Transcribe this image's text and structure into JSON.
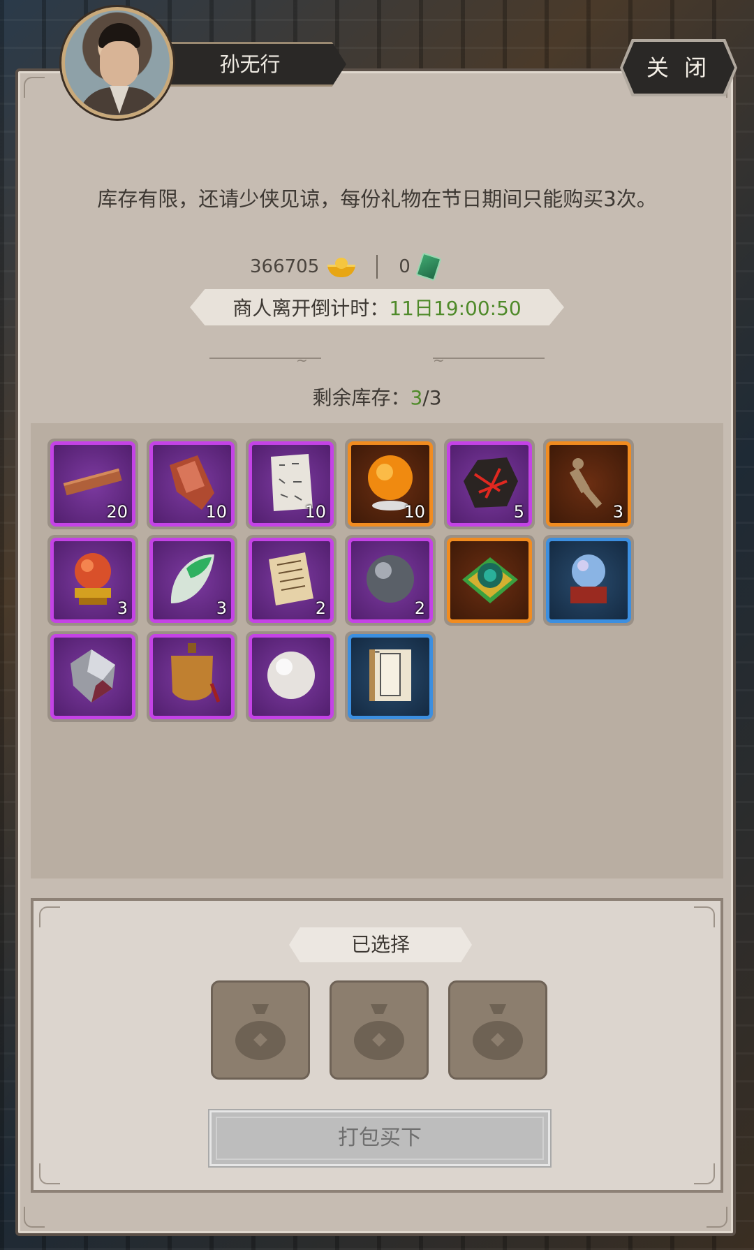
{
  "header": {
    "npc_name": "孙无行",
    "close_label": "关 闭"
  },
  "notice_text": "库存有限，还请少侠见谅，每份礼物在节日期间只能购买3次。",
  "currency": {
    "gold_amount": "366705",
    "gold_icon": "gold-ingot-icon",
    "jade_amount": "0",
    "jade_icon": "jade-token-icon"
  },
  "timer": {
    "label": "商人离开倒计时：",
    "value": "11日19:00:50"
  },
  "stock": {
    "label": "剩余库存：",
    "current": "3",
    "total": "/3"
  },
  "items": [
    {
      "name": "wood-plank",
      "rarity": "purple",
      "qty": "20"
    },
    {
      "name": "red-stone-shard",
      "rarity": "purple",
      "qty": "10"
    },
    {
      "name": "script-scroll",
      "rarity": "purple",
      "qty": "10"
    },
    {
      "name": "fire-orb",
      "rarity": "orange",
      "qty": "10"
    },
    {
      "name": "lava-ore",
      "rarity": "purple",
      "qty": "5"
    },
    {
      "name": "bronze-figure",
      "rarity": "orange",
      "qty": "3"
    },
    {
      "name": "red-orb-stand",
      "rarity": "purple",
      "qty": "3"
    },
    {
      "name": "jade-leaf",
      "rarity": "purple",
      "qty": "3"
    },
    {
      "name": "letter-paper",
      "rarity": "purple",
      "qty": "2"
    },
    {
      "name": "iron-ball",
      "rarity": "purple",
      "qty": "2"
    },
    {
      "name": "green-swirl-cloth",
      "rarity": "orange",
      "qty": ""
    },
    {
      "name": "crystal-orb-stand",
      "rarity": "blue",
      "qty": ""
    },
    {
      "name": "silver-crystal",
      "rarity": "purple",
      "qty": ""
    },
    {
      "name": "bronze-tag",
      "rarity": "purple",
      "qty": ""
    },
    {
      "name": "pearl",
      "rarity": "purple",
      "qty": ""
    },
    {
      "name": "book-manual",
      "rarity": "blue",
      "qty": ""
    }
  ],
  "stray_mark": "-",
  "selection": {
    "label": "已选择",
    "slot_icon": "money-bag-icon",
    "buy_label": "打包买下"
  }
}
